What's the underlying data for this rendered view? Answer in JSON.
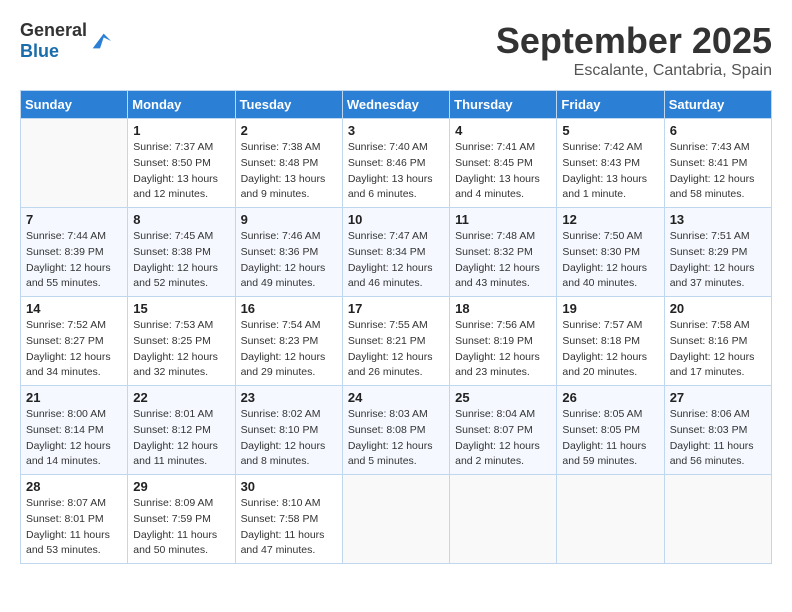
{
  "header": {
    "logo_general": "General",
    "logo_blue": "Blue",
    "month": "September 2025",
    "location": "Escalante, Cantabria, Spain"
  },
  "days_of_week": [
    "Sunday",
    "Monday",
    "Tuesday",
    "Wednesday",
    "Thursday",
    "Friday",
    "Saturday"
  ],
  "weeks": [
    [
      {
        "day": "",
        "info": ""
      },
      {
        "day": "1",
        "info": "Sunrise: 7:37 AM\nSunset: 8:50 PM\nDaylight: 13 hours\nand 12 minutes."
      },
      {
        "day": "2",
        "info": "Sunrise: 7:38 AM\nSunset: 8:48 PM\nDaylight: 13 hours\nand 9 minutes."
      },
      {
        "day": "3",
        "info": "Sunrise: 7:40 AM\nSunset: 8:46 PM\nDaylight: 13 hours\nand 6 minutes."
      },
      {
        "day": "4",
        "info": "Sunrise: 7:41 AM\nSunset: 8:45 PM\nDaylight: 13 hours\nand 4 minutes."
      },
      {
        "day": "5",
        "info": "Sunrise: 7:42 AM\nSunset: 8:43 PM\nDaylight: 13 hours\nand 1 minute."
      },
      {
        "day": "6",
        "info": "Sunrise: 7:43 AM\nSunset: 8:41 PM\nDaylight: 12 hours\nand 58 minutes."
      }
    ],
    [
      {
        "day": "7",
        "info": "Sunrise: 7:44 AM\nSunset: 8:39 PM\nDaylight: 12 hours\nand 55 minutes."
      },
      {
        "day": "8",
        "info": "Sunrise: 7:45 AM\nSunset: 8:38 PM\nDaylight: 12 hours\nand 52 minutes."
      },
      {
        "day": "9",
        "info": "Sunrise: 7:46 AM\nSunset: 8:36 PM\nDaylight: 12 hours\nand 49 minutes."
      },
      {
        "day": "10",
        "info": "Sunrise: 7:47 AM\nSunset: 8:34 PM\nDaylight: 12 hours\nand 46 minutes."
      },
      {
        "day": "11",
        "info": "Sunrise: 7:48 AM\nSunset: 8:32 PM\nDaylight: 12 hours\nand 43 minutes."
      },
      {
        "day": "12",
        "info": "Sunrise: 7:50 AM\nSunset: 8:30 PM\nDaylight: 12 hours\nand 40 minutes."
      },
      {
        "day": "13",
        "info": "Sunrise: 7:51 AM\nSunset: 8:29 PM\nDaylight: 12 hours\nand 37 minutes."
      }
    ],
    [
      {
        "day": "14",
        "info": "Sunrise: 7:52 AM\nSunset: 8:27 PM\nDaylight: 12 hours\nand 34 minutes."
      },
      {
        "day": "15",
        "info": "Sunrise: 7:53 AM\nSunset: 8:25 PM\nDaylight: 12 hours\nand 32 minutes."
      },
      {
        "day": "16",
        "info": "Sunrise: 7:54 AM\nSunset: 8:23 PM\nDaylight: 12 hours\nand 29 minutes."
      },
      {
        "day": "17",
        "info": "Sunrise: 7:55 AM\nSunset: 8:21 PM\nDaylight: 12 hours\nand 26 minutes."
      },
      {
        "day": "18",
        "info": "Sunrise: 7:56 AM\nSunset: 8:19 PM\nDaylight: 12 hours\nand 23 minutes."
      },
      {
        "day": "19",
        "info": "Sunrise: 7:57 AM\nSunset: 8:18 PM\nDaylight: 12 hours\nand 20 minutes."
      },
      {
        "day": "20",
        "info": "Sunrise: 7:58 AM\nSunset: 8:16 PM\nDaylight: 12 hours\nand 17 minutes."
      }
    ],
    [
      {
        "day": "21",
        "info": "Sunrise: 8:00 AM\nSunset: 8:14 PM\nDaylight: 12 hours\nand 14 minutes."
      },
      {
        "day": "22",
        "info": "Sunrise: 8:01 AM\nSunset: 8:12 PM\nDaylight: 12 hours\nand 11 minutes."
      },
      {
        "day": "23",
        "info": "Sunrise: 8:02 AM\nSunset: 8:10 PM\nDaylight: 12 hours\nand 8 minutes."
      },
      {
        "day": "24",
        "info": "Sunrise: 8:03 AM\nSunset: 8:08 PM\nDaylight: 12 hours\nand 5 minutes."
      },
      {
        "day": "25",
        "info": "Sunrise: 8:04 AM\nSunset: 8:07 PM\nDaylight: 12 hours\nand 2 minutes."
      },
      {
        "day": "26",
        "info": "Sunrise: 8:05 AM\nSunset: 8:05 PM\nDaylight: 11 hours\nand 59 minutes."
      },
      {
        "day": "27",
        "info": "Sunrise: 8:06 AM\nSunset: 8:03 PM\nDaylight: 11 hours\nand 56 minutes."
      }
    ],
    [
      {
        "day": "28",
        "info": "Sunrise: 8:07 AM\nSunset: 8:01 PM\nDaylight: 11 hours\nand 53 minutes."
      },
      {
        "day": "29",
        "info": "Sunrise: 8:09 AM\nSunset: 7:59 PM\nDaylight: 11 hours\nand 50 minutes."
      },
      {
        "day": "30",
        "info": "Sunrise: 8:10 AM\nSunset: 7:58 PM\nDaylight: 11 hours\nand 47 minutes."
      },
      {
        "day": "",
        "info": ""
      },
      {
        "day": "",
        "info": ""
      },
      {
        "day": "",
        "info": ""
      },
      {
        "day": "",
        "info": ""
      }
    ]
  ]
}
